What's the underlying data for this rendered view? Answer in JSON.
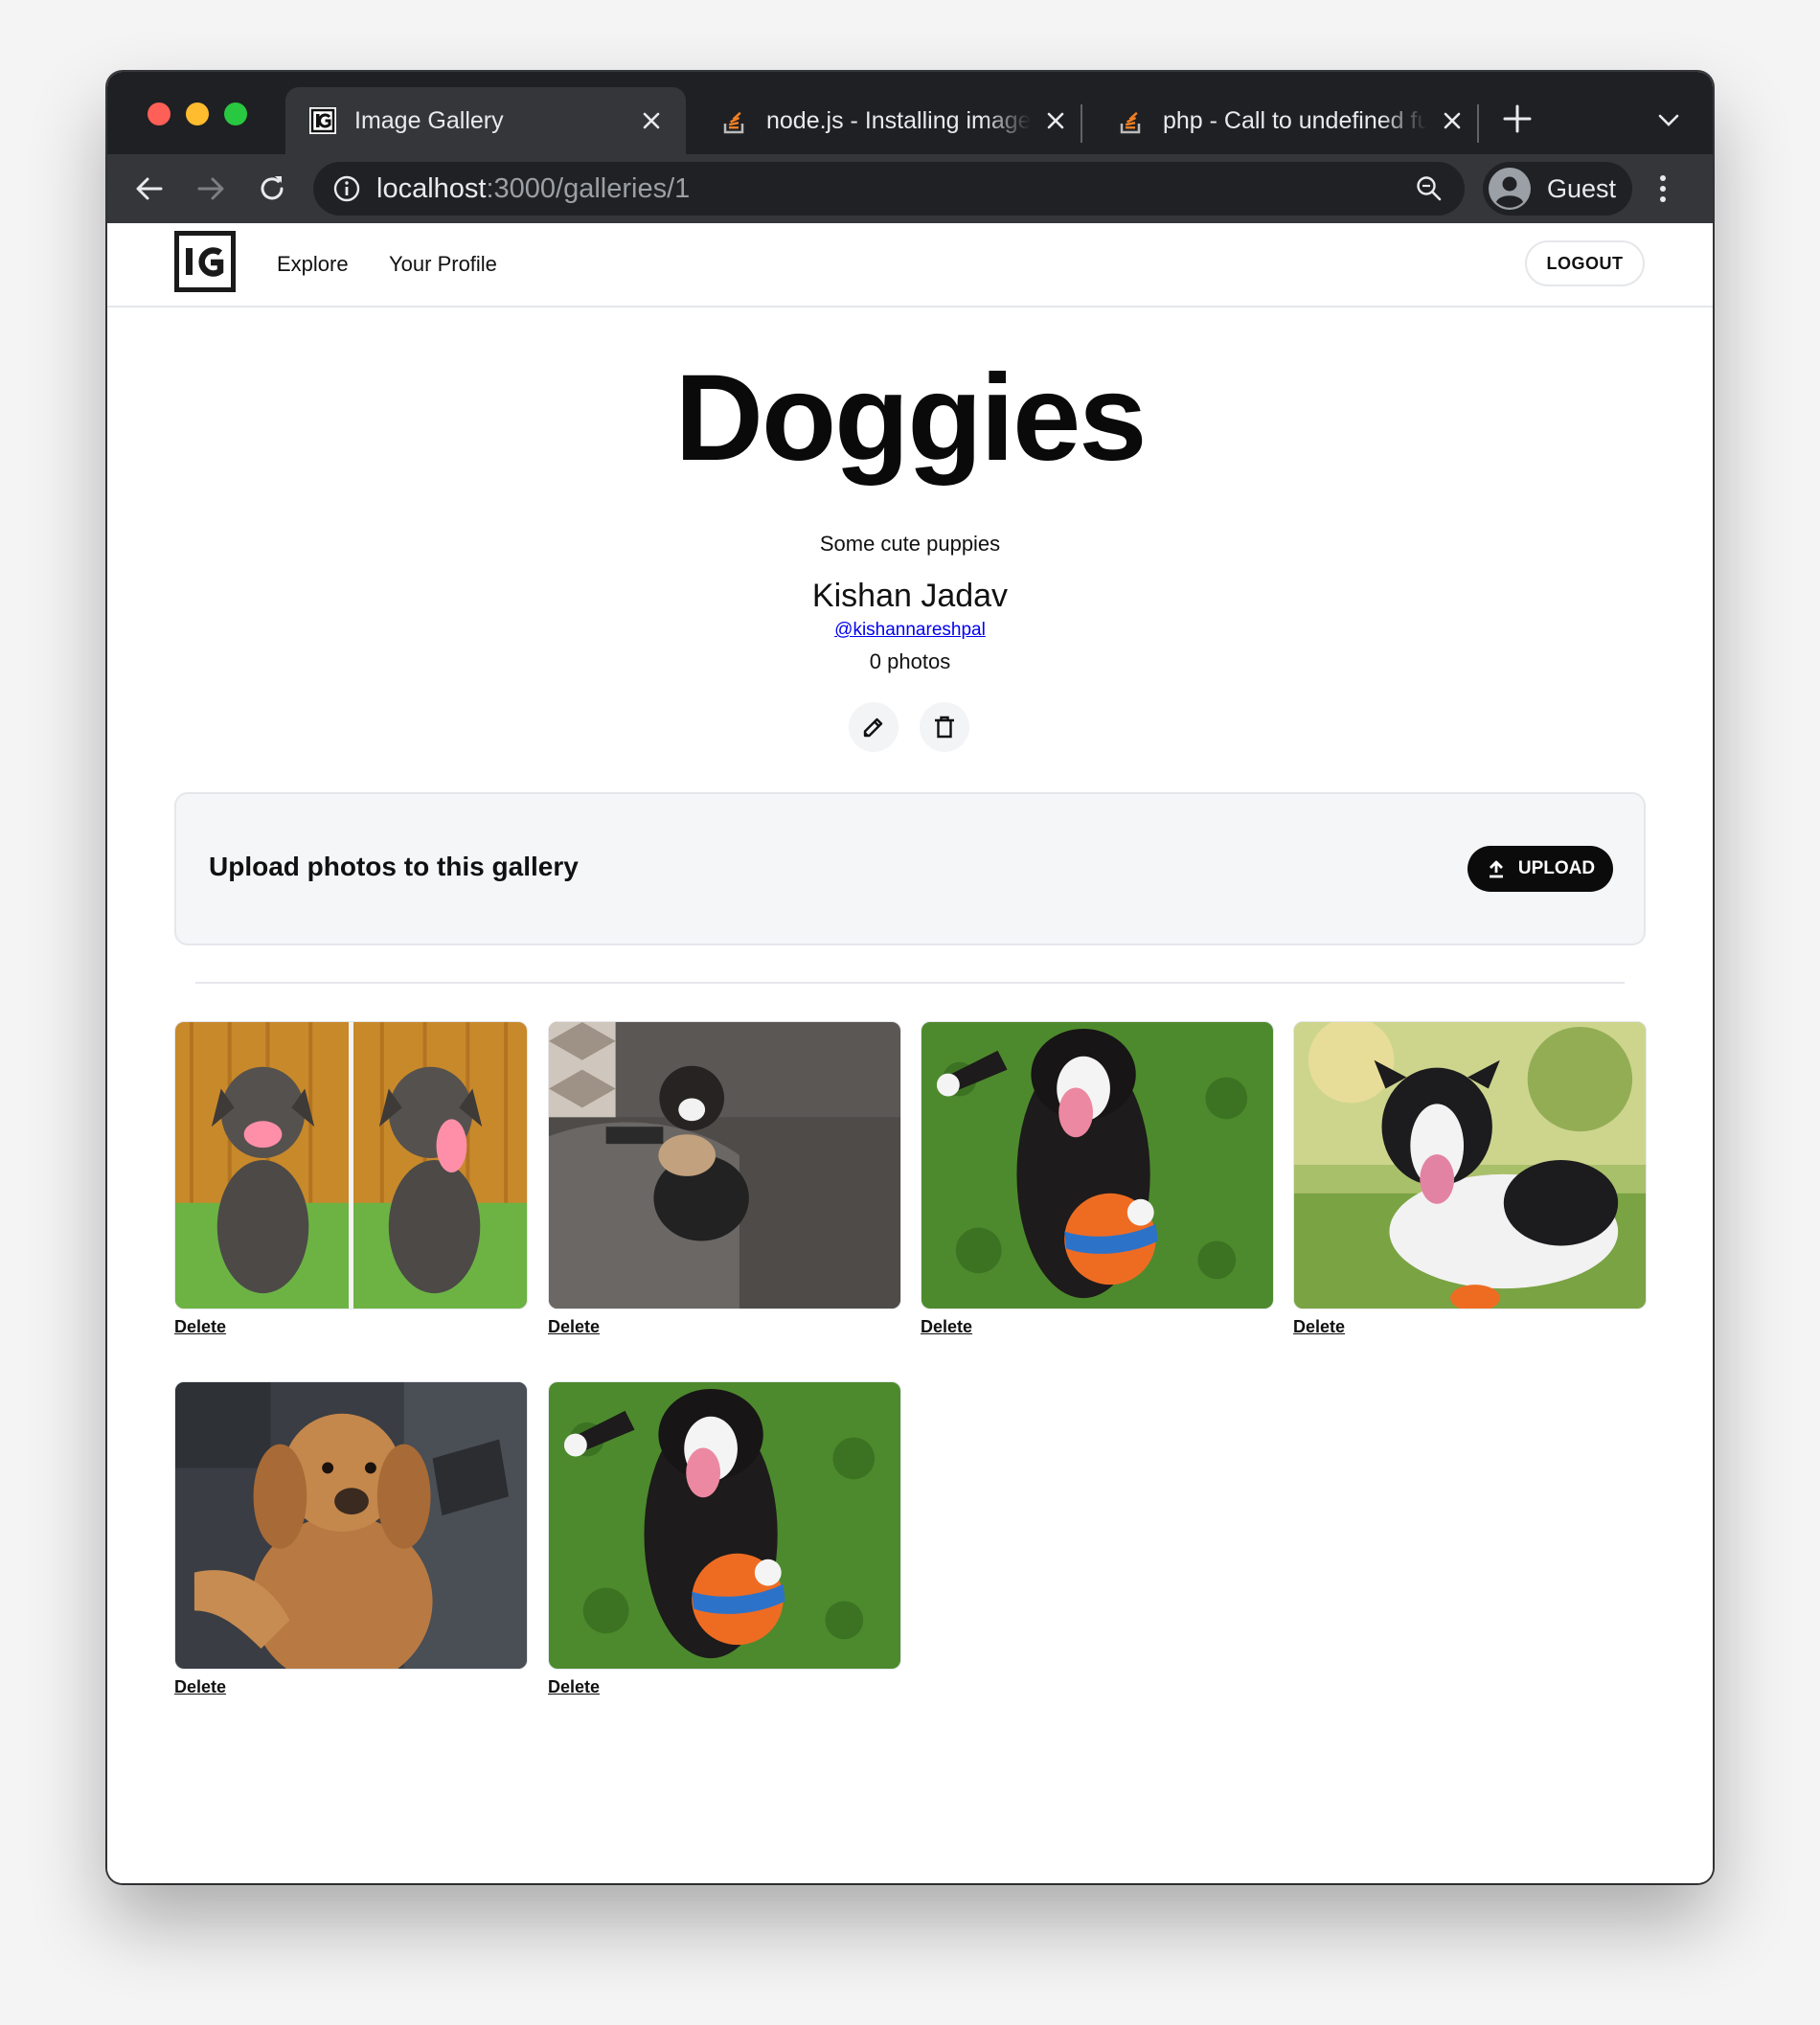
{
  "browser": {
    "tabs": [
      {
        "title": "Image Gallery",
        "icon": "gallery-logo-icon",
        "active": true
      },
      {
        "title": "node.js - Installing image",
        "icon": "stackoverflow-icon",
        "active": false
      },
      {
        "title": "php - Call to undefined fu",
        "icon": "stackoverflow-icon",
        "active": false
      }
    ],
    "url_host": "localhost",
    "url_path": ":3000/galleries/1",
    "profile_name": "Guest"
  },
  "nav": {
    "explore": "Explore",
    "profile": "Your Profile",
    "logout": "LOGOUT"
  },
  "gallery": {
    "title": "Doggies",
    "description": "Some cute puppies",
    "owner_name": "Kishan Jadav",
    "owner_handle": "@kishannareshpal",
    "photo_count": "0 photos"
  },
  "upload": {
    "label": "Upload photos to this gallery",
    "button": "UPLOAD"
  },
  "photos": [
    {
      "delete_label": "Delete",
      "subject": "two grey puppies side by side"
    },
    {
      "delete_label": "Delete",
      "subject": "small dog on grey couch"
    },
    {
      "delete_label": "Delete",
      "subject": "black and white dog with orange ball"
    },
    {
      "delete_label": "Delete",
      "subject": "border collie puppy on grass"
    },
    {
      "delete_label": "Delete",
      "subject": "golden puppy in car"
    },
    {
      "delete_label": "Delete",
      "subject": "black and white dog with orange ball"
    }
  ],
  "colors": {
    "tab_strip": "#1f2023",
    "toolbar": "#35363a",
    "omnibox": "#202124",
    "primary_button": "#0b0b0b"
  }
}
